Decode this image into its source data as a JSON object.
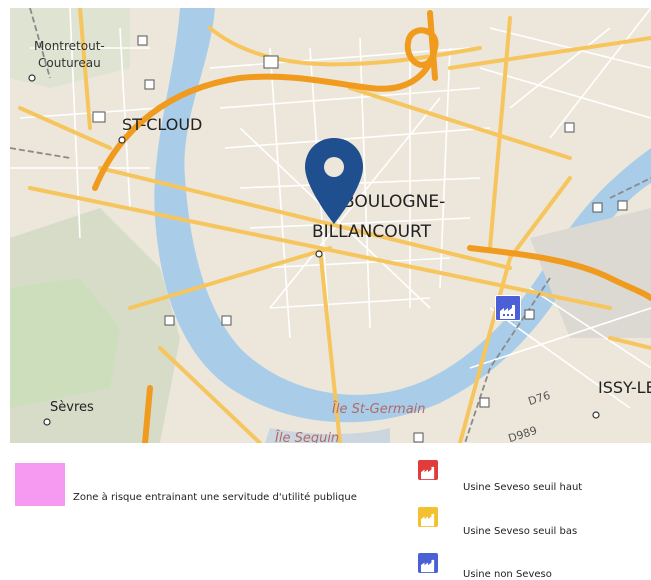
{
  "map": {
    "places": {
      "montretout": "Montretout-\nCoutureau",
      "st_cloud": "ST-CLOUD",
      "boulogne_1": "BOULOGNE-",
      "boulogne_2": "BILLANCOURT",
      "issy": "ISSY-LE",
      "sevres": "Sèvres",
      "ile_st_germain": "Île St-Germain",
      "ile_seguin": "Île Seguin",
      "road_d76": "D76",
      "road_d989": "D989"
    },
    "colors": {
      "land": "#ece7da",
      "water": "#a9cde9",
      "green": "#c9dfb8",
      "major_road": "#f6c55e",
      "highway": "#f09a1e",
      "rail": "#888888",
      "pin": "#1f4f8f"
    },
    "marker_icon": "map-pin-icon",
    "facility_icon": "factory-icon"
  },
  "legend": {
    "zone_label": "Zone à risque entrainant une servitude d'utilité publique",
    "zone_color": "#f59af0",
    "items": [
      {
        "label": "Usine Seveso seuil haut",
        "color": "#e03c3c"
      },
      {
        "label": "Usine Seveso seuil bas",
        "color": "#f2c12e"
      },
      {
        "label": "Usine non Seveso",
        "color": "#4b5fd6"
      }
    ]
  }
}
